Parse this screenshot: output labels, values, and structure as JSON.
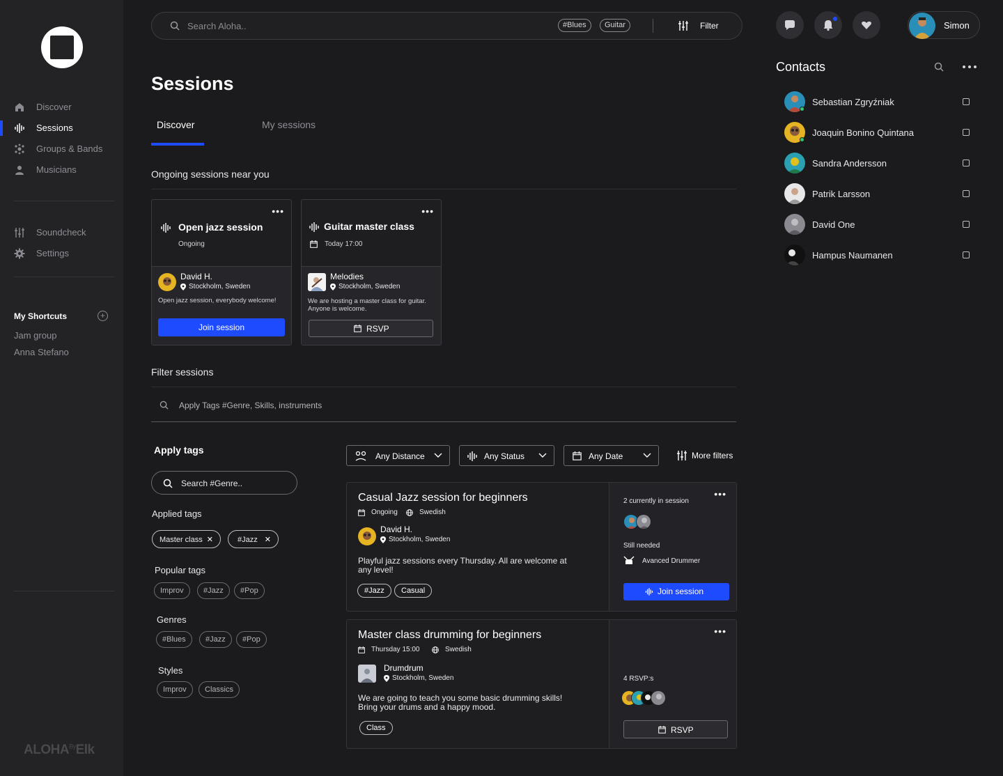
{
  "app": {
    "brand": "ALOHA",
    "brand_suffix": "By",
    "brand_tail": "Elk"
  },
  "sidebar": {
    "items": [
      {
        "label": "Discover",
        "icon": "home-icon"
      },
      {
        "label": "Sessions",
        "icon": "waveform-icon"
      },
      {
        "label": "Groups & Bands",
        "icon": "groups-icon"
      },
      {
        "label": "Musicians",
        "icon": "person-icon"
      }
    ],
    "tools": [
      {
        "label": "Soundcheck",
        "icon": "sliders-icon"
      },
      {
        "label": "Settings",
        "icon": "gear-icon"
      }
    ],
    "shortcuts_title": "My Shortcuts",
    "shortcuts_add": "+",
    "shortcuts": [
      "Jam group",
      "Anna Stefano"
    ]
  },
  "topbar": {
    "search_placeholder": "Search Aloha..",
    "chips": [
      "#Blues",
      "Guitar"
    ],
    "filter_label": "Filter",
    "user_name": "Simon"
  },
  "contacts": {
    "title": "Contacts",
    "list": [
      {
        "name": "Sebastian Zgryźniak",
        "online": true
      },
      {
        "name": "Joaquin Bonino Quintana",
        "online": true
      },
      {
        "name": "Sandra Andersson",
        "online": false
      },
      {
        "name": "Patrik Larsson",
        "online": false
      },
      {
        "name": "David One",
        "online": false
      },
      {
        "name": "Hampus Naumanen",
        "online": false
      }
    ]
  },
  "main": {
    "title": "Sessions",
    "tabs": [
      "Discover",
      "My sessions"
    ],
    "ongoing_title": "Ongoing sessions near you",
    "ongoing": [
      {
        "title": "Open jazz session",
        "status": "Ongoing",
        "host": "David H.",
        "location": "Stockholm, Sweden",
        "description": "Open jazz session, everybody welcome!",
        "action": "Join session"
      },
      {
        "title": "Guitar master class",
        "status": "Today 17:00",
        "host": "Melodies",
        "location": "Stockholm, Sweden",
        "description": "We are hosting a master class for guitar. Anyone is welcome.",
        "action": "RSVP"
      }
    ],
    "filter_title": "Filter sessions",
    "filter_placeholder": "Apply Tags #Genre, Skills, instruments"
  },
  "tags": {
    "title": "Apply tags",
    "search_placeholder": "Search #Genre..",
    "applied_title": "Applied tags",
    "applied": [
      "Master class",
      "#Jazz"
    ],
    "popular_title": "Popular tags",
    "popular": [
      "Improv",
      "#Jazz",
      "#Pop"
    ],
    "genres_title": "Genres",
    "genres": [
      "#Blues",
      "#Jazz",
      "#Pop"
    ],
    "styles_title": "Styles",
    "styles": [
      "Improv",
      "Classics"
    ]
  },
  "filters": {
    "distance": "Any Distance",
    "status": "Any Status",
    "date": "Any Date",
    "more": "More filters"
  },
  "sessions": [
    {
      "title": "Casual Jazz session for beginners",
      "when": "Ongoing",
      "language": "Swedish",
      "host": "David H.",
      "location": "Stockholm, Sweden",
      "description": "Playful jazz sessions every Thursday. All are welcome at any level!",
      "tags": [
        "#Jazz",
        "Casual"
      ],
      "attendance_label": "2 currently in session",
      "needed_label": "Still needed",
      "needed_role": "Avanced Drummer",
      "action": "Join session"
    },
    {
      "title": "Master class drumming for beginners",
      "when": "Thursday 15:00",
      "language": "Swedish",
      "host": "Drumdrum",
      "location": "Stockholm, Sweden",
      "description": "We are going to teach you some basic drumming skills! Bring your drums and a happy mood.",
      "tags": [
        "Class"
      ],
      "attendance_label": "4 RSVP:s",
      "action": "RSVP"
    }
  ],
  "colors": {
    "accent": "#1f4bff",
    "background": "#1b1b1d",
    "sidebar": "#232326",
    "online": "#2ecc71"
  }
}
